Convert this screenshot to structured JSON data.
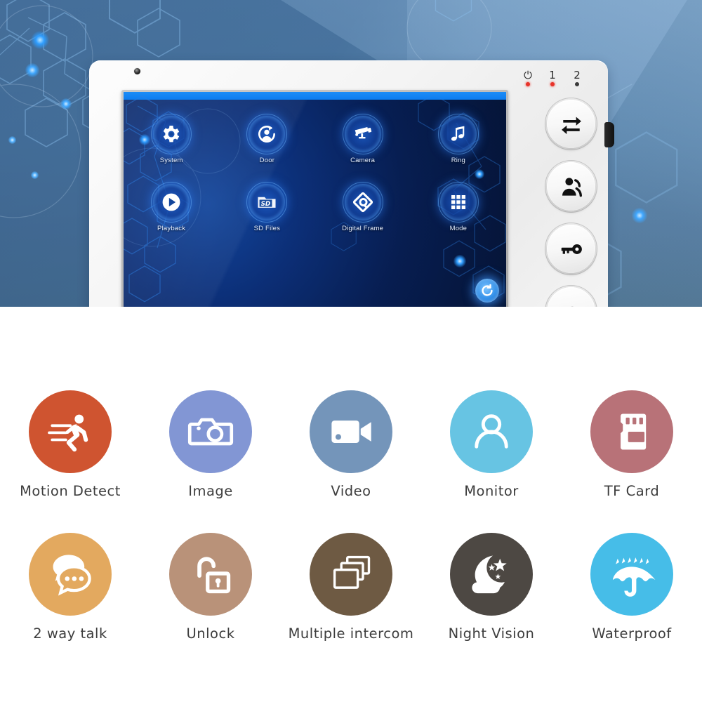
{
  "hero": {
    "background_top": "#5b86ae",
    "background_bottom": "#4f7491",
    "device": {
      "name": "video-door-phone-monitor",
      "lens_label": "camera-lens",
      "indicators": [
        {
          "glyph": "⏻",
          "name": "power-indicator",
          "state": "on"
        },
        {
          "glyph": "1",
          "name": "channel-1-indicator",
          "state": "on"
        },
        {
          "glyph": "2",
          "name": "channel-2-indicator",
          "state": "off"
        }
      ],
      "led_on_color": "#e8332a",
      "led_off_color": "#3a3a3a",
      "hardware_buttons": [
        {
          "icon": "switch-arrows-icon",
          "label": "switch"
        },
        {
          "icon": "intercom-people-icon",
          "label": "intercom"
        },
        {
          "icon": "key-unlock-icon",
          "label": "unlock"
        },
        {
          "icon": "hangup-phone-icon",
          "label": "talk-hangup"
        }
      ],
      "side_button": "side-knob"
    },
    "screen": {
      "topbar_color": "#1c8cf7",
      "refresh_icon": "refresh-back-icon",
      "menu": [
        {
          "icon": "gear-icon",
          "label": "System"
        },
        {
          "icon": "door-person-icon",
          "label": "Door"
        },
        {
          "icon": "cctv-camera-icon",
          "label": "Camera"
        },
        {
          "icon": "music-note-icon",
          "label": "Ring"
        },
        {
          "icon": "play-circle-icon",
          "label": "Playback"
        },
        {
          "icon": "sd-card-folder-icon",
          "label": "SD Files"
        },
        {
          "icon": "photo-frame-icon",
          "label": "Digital Frame"
        },
        {
          "icon": "grid-squares-icon",
          "label": "Mode"
        }
      ]
    }
  },
  "features": {
    "label_color": "#3d3d3d",
    "rows": [
      [
        {
          "label": "Motion  Detect",
          "icon": "running-man-icon",
          "color": "#cf5430"
        },
        {
          "label": "Image",
          "icon": "camera-photo-icon",
          "color": "#8296d4"
        },
        {
          "label": "Video",
          "icon": "video-camera-icon",
          "color": "#7495ba"
        },
        {
          "label": "Monitor",
          "icon": "person-monitor-icon",
          "color": "#67c4e3"
        },
        {
          "label": "TF Card",
          "icon": "tf-card-icon",
          "color": "#b87278"
        }
      ],
      [
        {
          "label": "2 way talk",
          "icon": "chat-bubbles-icon",
          "color": "#e3a95f"
        },
        {
          "label": "Unlock",
          "icon": "open-padlock-icon",
          "color": "#b99279"
        },
        {
          "label": "Multiple  intercom",
          "icon": "stacked-frames-icon",
          "color": "#6e5a43"
        },
        {
          "label": "Night  Vision",
          "icon": "moon-cloud-stars-icon",
          "color": "#4d4843"
        },
        {
          "label": "Waterproof",
          "icon": "umbrella-rain-icon",
          "color": "#46bde8"
        }
      ]
    ]
  }
}
